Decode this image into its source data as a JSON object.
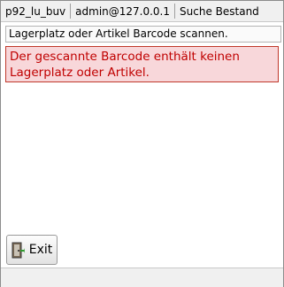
{
  "status": {
    "terminal": "p92_lu_buv",
    "user": "admin@127.0.0.1",
    "screen": "Suche Bestand"
  },
  "prompt": "Lagerplatz oder Artikel Barcode scannen.",
  "error": {
    "message": "Der gescannte Barcode enthält keinen Lagerplatz oder Artikel."
  },
  "buttons": {
    "exit": {
      "label": "Exit",
      "icon": "door-exit-icon"
    }
  },
  "colors": {
    "error_bg": "#f8d7da",
    "error_border": "#c0392b",
    "error_text": "#c00000"
  }
}
